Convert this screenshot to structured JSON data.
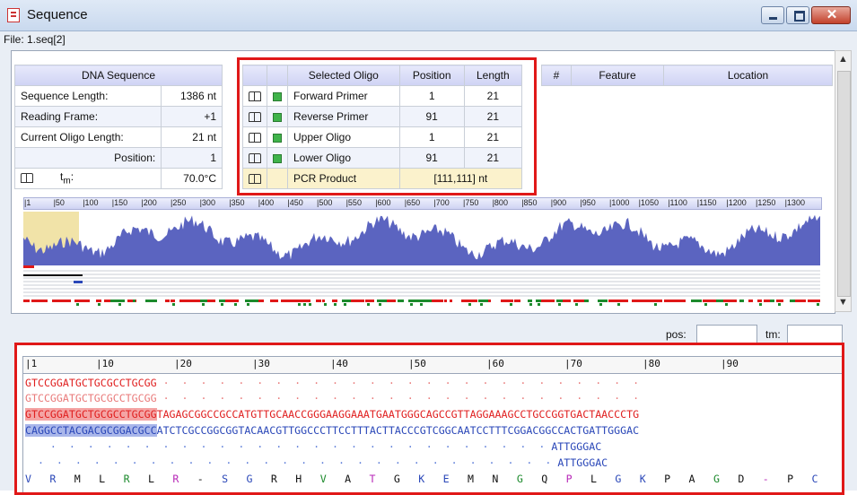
{
  "window": {
    "title": "Sequence",
    "close_label": "✕"
  },
  "file_label": "File: 1.seq[2]",
  "dna_table": {
    "header": "DNA Sequence",
    "rows": [
      {
        "label": "Sequence Length:",
        "value": "1386 nt"
      },
      {
        "label": "Reading Frame:",
        "value": "+1"
      },
      {
        "label": "Current Oligo Length:",
        "value": "21 nt"
      },
      {
        "label": "Position:",
        "value": "1"
      },
      {
        "label": "t",
        "sub": "m",
        "suffix": ":",
        "value": "70.0°C"
      }
    ]
  },
  "oligo_table": {
    "headers": [
      "Selected Oligo",
      "Position",
      "Length"
    ],
    "rows": [
      {
        "name": "Forward Primer",
        "position": "1",
        "length": "21"
      },
      {
        "name": "Reverse Primer",
        "position": "91",
        "length": "21"
      },
      {
        "name": "Upper Oligo",
        "position": "1",
        "length": "21"
      },
      {
        "name": "Lower Oligo",
        "position": "91",
        "length": "21"
      }
    ],
    "pcr": {
      "name": "PCR Product",
      "value": "[111,111] nt"
    }
  },
  "feature_table": {
    "headers": [
      "#",
      "Feature",
      "Location"
    ]
  },
  "map_ruler": [
    "1",
    "50",
    "100",
    "150",
    "200",
    "250",
    "300",
    "350",
    "400",
    "450",
    "500",
    "550",
    "600",
    "650",
    "700",
    "750",
    "800",
    "850",
    "900",
    "950",
    "1000",
    "1050",
    "1100",
    "1150",
    "1200",
    "1250",
    "1300"
  ],
  "pos_label": "pos:",
  "tm_label": "tm:",
  "seq_ruler": [
    "1",
    "10",
    "20",
    "30",
    "40",
    "50",
    "60",
    "70",
    "80",
    "90"
  ],
  "sequence": {
    "forward_primer": "GTCCGGATGCTGCGCCTGCGG",
    "upper_oligo": "GTCCGGATGCTGCGCCTGCGG",
    "top_strand_highlight": "GTCCGGATGCTGCGCCTGCGG",
    "top_strand_rest": "TAGAGCGGCCGCCATGTTGCAACCGGGAAGGAAATGAATGGGCAGCCGTTAGGAAAGCCTGCCGGTGACTAACCCTG",
    "bottom_strand_highlight": "CAGGCCTACGACGCGGACGCC",
    "bottom_strand_rest": "ATCTCGCCGGCGGTACAACGTTGGCCCTTCCTTTACTTACCCGTCGGCAATCCTTTCGGACGGCCACTGATTGGGAC",
    "reverse_primer_tail": "ATTGGGAC",
    "lower_oligo_tail": "ATTGGGAC",
    "translation": [
      "V",
      "R",
      "M",
      "L",
      "R",
      "L",
      "R",
      "-",
      "S",
      "G",
      "R",
      "H",
      "V",
      "A",
      "T",
      "G",
      "K",
      "E",
      "M",
      "N",
      "G",
      "Q",
      "P",
      "L",
      "G",
      "K",
      "P",
      "A",
      "G",
      "D",
      "-",
      "P",
      "C"
    ]
  },
  "colors": {
    "highlight_box": "#e01818",
    "profile_fill": "#5b64c0",
    "primer_region": "#f1e3a8"
  }
}
